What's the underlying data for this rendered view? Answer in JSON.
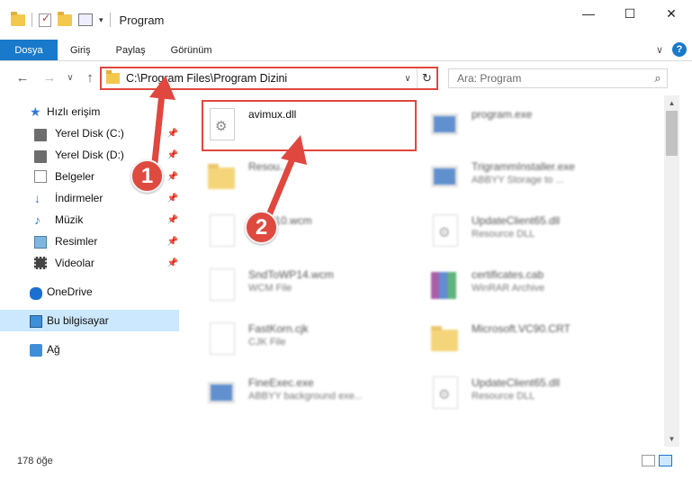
{
  "window": {
    "title": "Program",
    "caption": {
      "minimize": "—",
      "maximize": "☐",
      "close": "✕"
    }
  },
  "qat": {
    "dropdown": "▾"
  },
  "ribbon": {
    "tabs": [
      "Dosya",
      "Giriş",
      "Paylaş",
      "Görünüm"
    ],
    "help": "?",
    "expand": "∨"
  },
  "nav": {
    "back": "←",
    "forward": "→",
    "recent": "∨",
    "up": "↑"
  },
  "address": {
    "path": "C:\\Program Files\\Program Dizini",
    "dropdown": "∨",
    "refresh": "↻"
  },
  "search": {
    "placeholder": "Ara: Program",
    "icon": "⌕"
  },
  "sidebar": {
    "quick_access": "Hızlı erişim",
    "items": [
      {
        "label": "Yerel Disk (C:)",
        "icon": "drive-icon"
      },
      {
        "label": "Yerel Disk (D:)",
        "icon": "drive-icon"
      },
      {
        "label": "Belgeler",
        "icon": "documents-icon"
      },
      {
        "label": "İndirmeler",
        "icon": "downloads-icon"
      },
      {
        "label": "Müzik",
        "icon": "music-icon"
      },
      {
        "label": "Resimler",
        "icon": "pictures-icon"
      },
      {
        "label": "Videolar",
        "icon": "videos-icon"
      }
    ],
    "onedrive": "OneDrive",
    "this_pc": "Bu bilgisayar",
    "network": "Ağ",
    "pin_glyph": "📌"
  },
  "files": [
    {
      "name": "avimux.dll",
      "type": "",
      "icon": "dll-gear-icon"
    },
    {
      "name": "program.exe",
      "type": "",
      "icon": "exe-icon"
    },
    {
      "name": "Resou...",
      "type": "",
      "icon": "folder-icon"
    },
    {
      "name": "TrigrammInstaller.exe",
      "type": "ABBYY Storage to ...",
      "icon": "exe-icon"
    },
    {
      "name": "...WP10.wcm",
      "type": "...File",
      "icon": "document-icon"
    },
    {
      "name": "UpdateClient65.dll",
      "type": "Resource DLL",
      "icon": "dll-gear-icon"
    },
    {
      "name": "SndToWP14.wcm",
      "type": "WCM File",
      "icon": "document-icon"
    },
    {
      "name": "certificates.cab",
      "type": "WinRAR Archive",
      "icon": "archive-icon"
    },
    {
      "name": "FastKorn.cjk",
      "type": "CJK File",
      "icon": "document-icon"
    },
    {
      "name": "Microsoft.VC90.CRT",
      "type": "",
      "icon": "folder-icon"
    },
    {
      "name": "FineExec.exe",
      "type": "ABBYY background exe...",
      "icon": "exe-icon"
    },
    {
      "name": "UpdateClient65.dll",
      "type": "Resource DLL",
      "icon": "dll-gear-icon"
    }
  ],
  "scrollbar": {
    "up": "▲",
    "down": "▼"
  },
  "status": {
    "item_count": "178 öğe"
  },
  "annotations": {
    "step1": "1",
    "step2": "2"
  },
  "colors": {
    "accent": "#1979ca",
    "annotation": "#e0473e",
    "selected": "#cce8ff"
  }
}
